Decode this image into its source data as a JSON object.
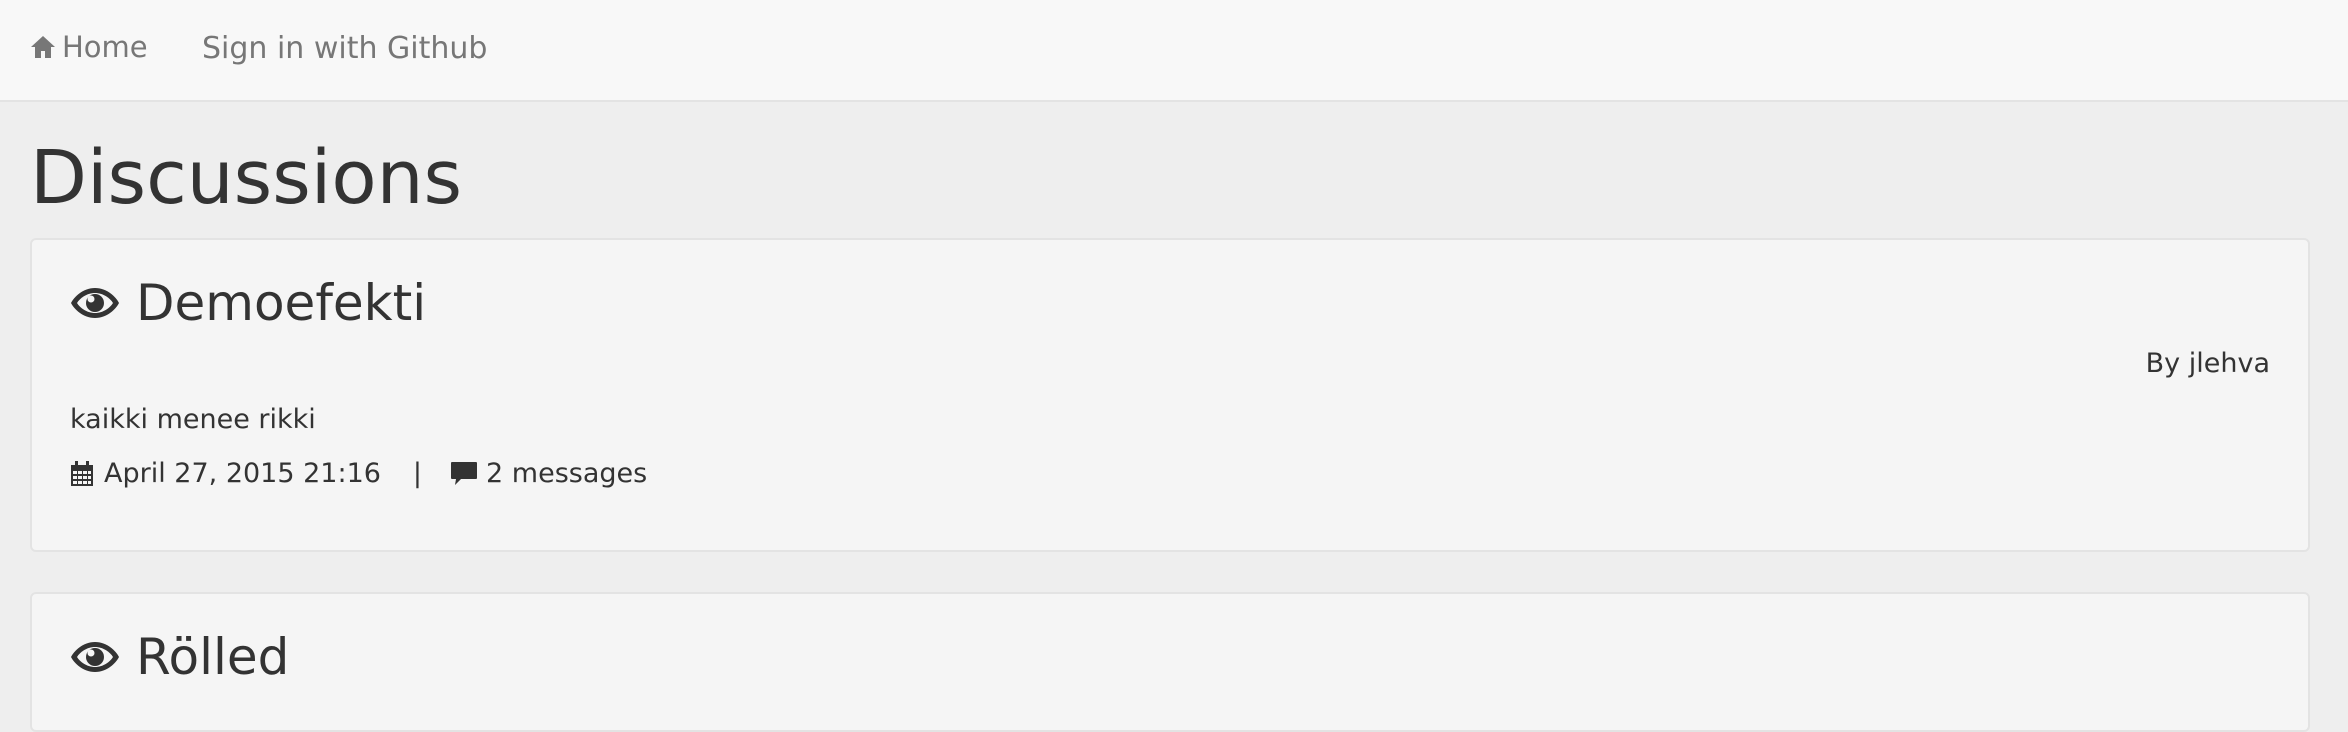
{
  "nav": {
    "home_label": "Home",
    "signin_label": "Sign in with Github",
    "home_icon": "home-icon"
  },
  "page": {
    "title": "Discussions"
  },
  "discussions": [
    {
      "title": "Demoefekti",
      "author_text": "By jlehva",
      "description": "kaikki menee rikki",
      "date": "April 27, 2015 21:16",
      "separator": "|",
      "messages": "2 messages",
      "title_icon": "eye-icon",
      "date_icon": "calendar-icon",
      "messages_icon": "comment-icon"
    },
    {
      "title": "Rölled",
      "title_icon": "eye-icon"
    }
  ],
  "colors": {
    "navbar_bg": "#f8f8f8",
    "page_bg": "#eeeeee",
    "card_bg": "#f5f5f5",
    "text": "#333333",
    "nav_text": "#777777"
  }
}
